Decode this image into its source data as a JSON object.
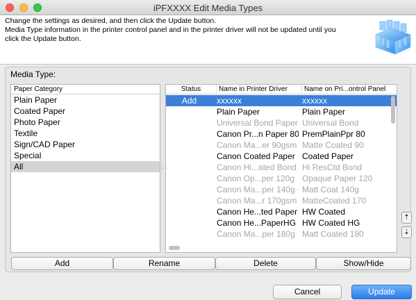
{
  "window": {
    "title": "iPFXXXX Edit Media Types"
  },
  "instructions": [
    "Change the settings as desired, and then click the Update button.",
    "Media Type information in the printer control panel and in the printer driver will not be updated until you",
    "click the Update button."
  ],
  "media_type_label": "Media Type:",
  "categories": {
    "header": "Paper Category",
    "items": [
      "Plain Paper",
      "Coated Paper",
      "Photo Paper",
      "Textile",
      "Sign/CAD Paper",
      "Special",
      "All"
    ],
    "selected": "All"
  },
  "media_table": {
    "columns": [
      "Status",
      "Name in Printer Driver",
      "Name on Pri...ontrol Panel"
    ],
    "rows": [
      {
        "status": "Add",
        "driver": "xxxxxx",
        "panel": "xxxxxx",
        "selected": true,
        "gray": false
      },
      {
        "status": "",
        "driver": "Plain Paper",
        "panel": "Plain Paper",
        "selected": false,
        "gray": false
      },
      {
        "status": "",
        "driver": "Universal Bond Paper",
        "panel": "Universal Bond",
        "selected": false,
        "gray": true
      },
      {
        "status": "",
        "driver": "Canon Pr...n Paper 80",
        "panel": "PremPlainPpr 80",
        "selected": false,
        "gray": false
      },
      {
        "status": "",
        "driver": "Canon Ma...er 90gsm",
        "panel": "Matte Coated 90",
        "selected": false,
        "gray": true
      },
      {
        "status": "",
        "driver": "Canon Coated Paper",
        "panel": "Coated Paper",
        "selected": false,
        "gray": false
      },
      {
        "status": "",
        "driver": "Canon Hi...ated Bond",
        "panel": "Hi ResCtd Bond",
        "selected": false,
        "gray": true
      },
      {
        "status": "",
        "driver": "Canon Op...per 120g",
        "panel": "Opaque Paper 120",
        "selected": false,
        "gray": true
      },
      {
        "status": "",
        "driver": "Canon Ma...per 140g",
        "panel": "Matt Coat 140g",
        "selected": false,
        "gray": true
      },
      {
        "status": "",
        "driver": "Canon Ma...r 170gsm",
        "panel": "MatteCoated 170",
        "selected": false,
        "gray": true
      },
      {
        "status": "",
        "driver": "Canon He...ted Paper",
        "panel": "HW Coated",
        "selected": false,
        "gray": false
      },
      {
        "status": "",
        "driver": "Canon He...PaperHG",
        "panel": "HW Coated HG",
        "selected": false,
        "gray": false
      },
      {
        "status": "",
        "driver": "Canon Ma...per 180g",
        "panel": "Matt Coated 180",
        "selected": false,
        "gray": true
      }
    ]
  },
  "side_buttons": [
    {
      "name": "move-up-icon",
      "glyph": "⇡"
    },
    {
      "name": "move-down-icon",
      "glyph": "⇣"
    }
  ],
  "action_buttons": {
    "add": "Add",
    "rename": "Rename",
    "delete": "Delete",
    "show_hide": "Show/Hide"
  },
  "footer_buttons": {
    "cancel": "Cancel",
    "update": "Update"
  },
  "colors": {
    "selection": "#3b7fd9",
    "update_button": "#2b7de6",
    "disabled_text": "#a6a6a6"
  }
}
